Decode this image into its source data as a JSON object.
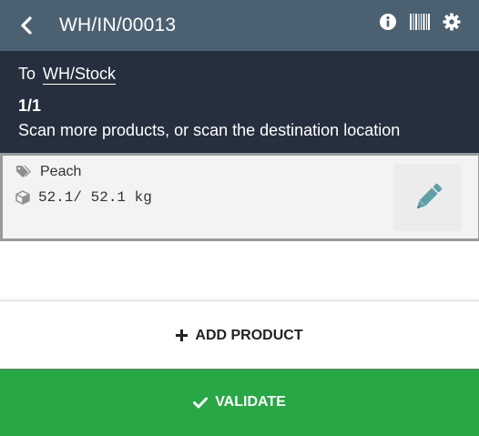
{
  "navbar": {
    "title": "WH/IN/00013",
    "icons": [
      "back-icon",
      "info-icon",
      "barcode-icon",
      "gear-icon"
    ]
  },
  "header": {
    "dest_prefix": "To",
    "dest_location": "WH/Stock",
    "counter": "1/1",
    "instructions": "Scan more products, or scan the destination location"
  },
  "line": {
    "product": "Peach",
    "quantity": "52.1/ 52.1 kg"
  },
  "actions": {
    "add_product": "ADD PRODUCT",
    "validate": "VALIDATE"
  },
  "colors": {
    "navbar": "#4b6172",
    "header": "#262f3e",
    "validate": "#28a745",
    "edit_icon": "#5f9fa5"
  }
}
